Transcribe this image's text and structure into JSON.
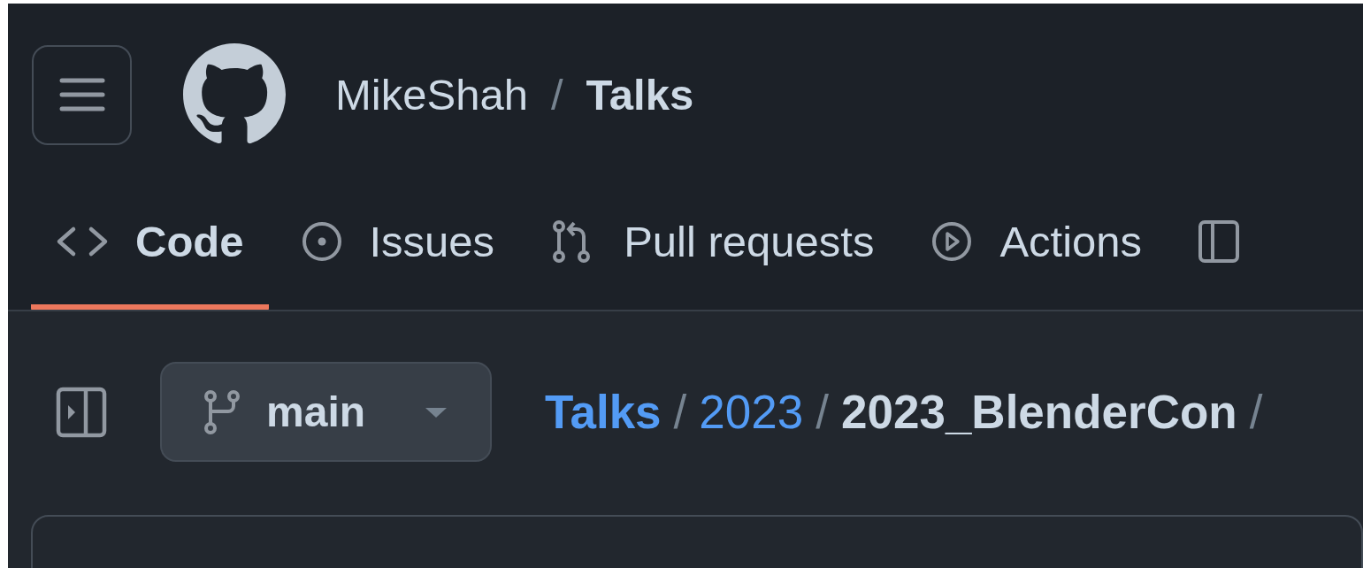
{
  "header": {
    "owner": "MikeShah",
    "separator": "/",
    "repo": "Talks"
  },
  "tabs": [
    {
      "kind": "code",
      "label": "Code",
      "selected": true
    },
    {
      "kind": "issue",
      "label": "Issues",
      "selected": false
    },
    {
      "kind": "pull",
      "label": "Pull requests",
      "selected": false
    },
    {
      "kind": "play",
      "label": "Actions",
      "selected": false
    },
    {
      "kind": "table",
      "selected": false
    }
  ],
  "branch": {
    "name": "main"
  },
  "breadcrumb": [
    {
      "text": "Talks",
      "kind": "link"
    },
    {
      "text": "/",
      "kind": "sep"
    },
    {
      "text": "2023",
      "kind": "link"
    },
    {
      "text": "/",
      "kind": "sep"
    },
    {
      "text": "2023_BlenderCon",
      "kind": "current"
    },
    {
      "text": "/",
      "kind": "sep"
    }
  ]
}
